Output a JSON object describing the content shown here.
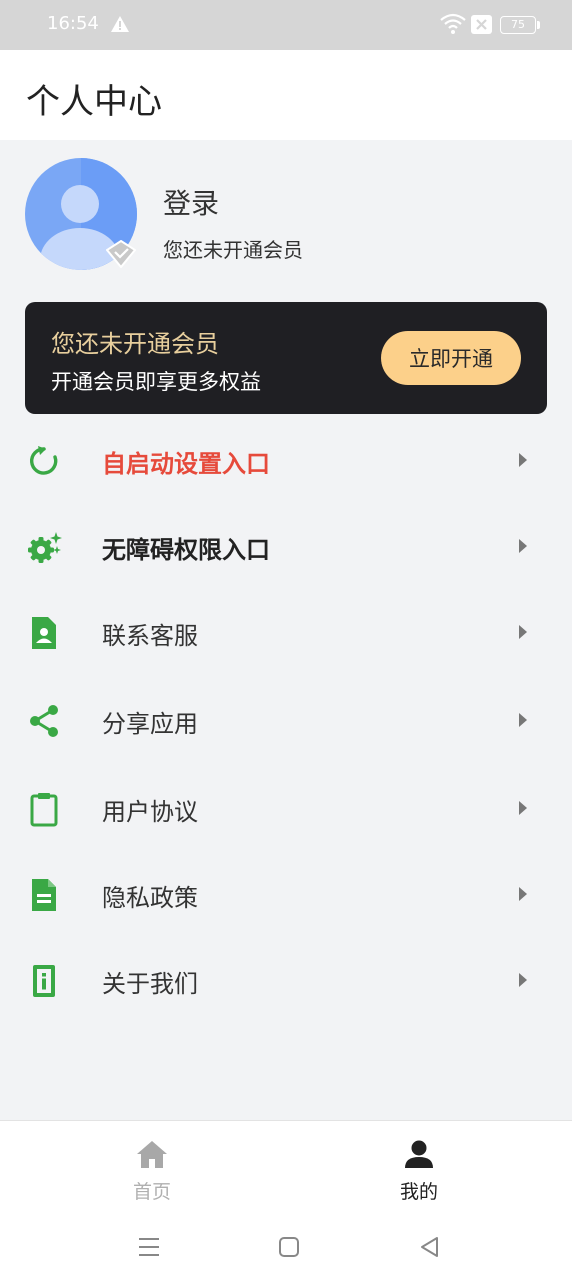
{
  "status_bar": {
    "time": "16:54",
    "battery": "75"
  },
  "header": {
    "title": "个人中心"
  },
  "profile": {
    "login_label": "登录",
    "member_status": "您还未开通会员"
  },
  "vip_card": {
    "title": "您还未开通会员",
    "subtitle": "开通会员即享更多权益",
    "button_label": "立即开通"
  },
  "menu": {
    "items": [
      {
        "label": "自启动设置入口",
        "icon": "refresh-icon"
      },
      {
        "label": "无障碍权限入口",
        "icon": "gear-sparkle-icon"
      },
      {
        "label": "联系客服",
        "icon": "contact-card-icon"
      },
      {
        "label": "分享应用",
        "icon": "share-icon"
      },
      {
        "label": "用户协议",
        "icon": "clipboard-icon"
      },
      {
        "label": "隐私政策",
        "icon": "document-icon"
      },
      {
        "label": "关于我们",
        "icon": "info-icon"
      }
    ]
  },
  "bottom_nav": {
    "tabs": [
      {
        "label": "首页",
        "icon": "home-icon",
        "active": false
      },
      {
        "label": "我的",
        "icon": "person-icon",
        "active": true
      }
    ]
  },
  "colors": {
    "accent_green": "#3aa845",
    "highlight_red": "#e64a3b",
    "vip_gold": "#e8cf9d",
    "vip_button": "#fcd08a",
    "card_dark": "#1f1f23"
  }
}
